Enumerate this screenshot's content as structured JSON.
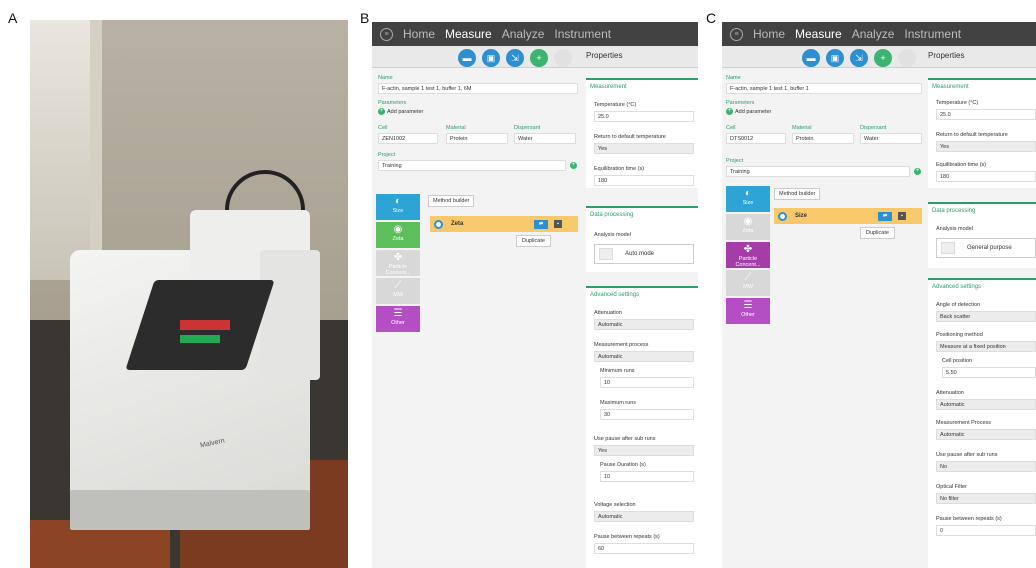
{
  "panel_labels": {
    "a": "A",
    "b": "B",
    "c": "C"
  },
  "photo": {
    "brand": "Malvern"
  },
  "nav": {
    "home": "Home",
    "measure": "Measure",
    "analyze": "Analyze",
    "instrument": "Instrument"
  },
  "icons": {
    "menu": "menu-icon",
    "open": "folder-icon",
    "save": "save-icon",
    "export": "export-icon",
    "add": "plus-icon"
  },
  "colors": {
    "accent": "#2a9d6a",
    "blue": "#2b8fd1",
    "orange": "#f7c96b",
    "topbar": "#424242"
  },
  "panelB": {
    "properties": "Properties",
    "name_label": "Name",
    "name_value": "F-actin, sample 1 test 1, buffer 1, 6M",
    "parameters_label": "Parameters",
    "add_parameter": "Add parameter",
    "cell_label": "Cell",
    "cell_value": "ZEN1002",
    "material_label": "Material",
    "material_value": "Protein",
    "dispersant_label": "Dispersant",
    "dispersant_value": "Water",
    "project_label": "Project",
    "project_value": "Training",
    "tiles": [
      {
        "label": "Size",
        "color": "#2ea3d6"
      },
      {
        "label": "Zeta",
        "color": "#5cbf5c"
      },
      {
        "label": "Particle Concent...",
        "color": "#d8d8d8"
      },
      {
        "label": "MW",
        "color": "#d8d8d8"
      },
      {
        "label": "Other",
        "color": "#b34fc2"
      }
    ],
    "method_builder": "Method builder",
    "method_row": "Zeta",
    "duplicate": "Duplicate",
    "measurement_title": "Measurement",
    "temperature_label": "Temperature (°C)",
    "temperature_value": "25.0",
    "return_label": "Return to default temperature",
    "return_value": "Yes",
    "equil_label": "Equilibration time (s)",
    "equil_value": "180",
    "dp_title": "Data processing",
    "analysis_label": "Analysis model",
    "analysis_value": "Auto mode",
    "adv_title": "Advanced settings",
    "atten_label": "Attenuation",
    "atten_value": "Automatic",
    "mproc_label": "Measurement process",
    "mproc_value": "Automatic",
    "minruns_label": "Minimum runs",
    "minruns_value": "10",
    "maxruns_label": "Maximum runs",
    "maxruns_value": "30",
    "pause_sub_label": "Use pause after sub runs",
    "pause_sub_value": "Yes",
    "pause_dur_label": "Pause Duration (s)",
    "pause_dur_value": "10",
    "volt_label": "Voltage selection",
    "volt_value": "Automatic",
    "pause_rep_label": "Pause between repeats (s)",
    "pause_rep_value": "60"
  },
  "panelC": {
    "properties": "Properties",
    "name_label": "Name",
    "name_value": "F-actin, sample 1 test 1, buffer 1",
    "parameters_label": "Parameters",
    "add_parameter": "Add parameter",
    "cell_label": "Cell",
    "cell_value": "DTS0012",
    "material_label": "Material",
    "material_value": "Protein",
    "dispersant_label": "Dispersant",
    "dispersant_value": "Water",
    "project_label": "Project",
    "project_value": "Training",
    "tiles": [
      {
        "label": "Size",
        "color": "#2ea3d6"
      },
      {
        "label": "Zeta",
        "color": "#d8d8d8"
      },
      {
        "label": "Particle Concent...",
        "color": "#a53da8"
      },
      {
        "label": "MW",
        "color": "#d8d8d8"
      },
      {
        "label": "Other",
        "color": "#b34fc2"
      }
    ],
    "method_builder": "Method builder",
    "method_row": "Size",
    "duplicate": "Duplicate",
    "measurement_title": "Measurement",
    "temperature_label": "Temperature (°C)",
    "temperature_value": "25.0",
    "return_label": "Return to default temperature",
    "return_value": "Yes",
    "equil_label": "Equilibration time (s)",
    "equil_value": "180",
    "dp_title": "Data processing",
    "analysis_label": "Analysis model",
    "analysis_value": "General purpose",
    "adv_title": "Advanced settings",
    "angle_label": "Angle of detection",
    "angle_value": "Back scatter",
    "pos_label": "Positioning method",
    "pos_value": "Measure at a fixed position",
    "cellpos_label": "Cell position",
    "cellpos_value": "5.50",
    "atten_label": "Attenuation",
    "atten_value": "Automatic",
    "mproc_label": "Measurement Process",
    "mproc_value": "Automatic",
    "pause_sub_label": "Use pause after sub runs",
    "pause_sub_value": "No",
    "filter_label": "Optical Filter",
    "filter_value": "No filter",
    "pause_rep_label": "Pause between repeats (s)",
    "pause_rep_value": "0"
  }
}
